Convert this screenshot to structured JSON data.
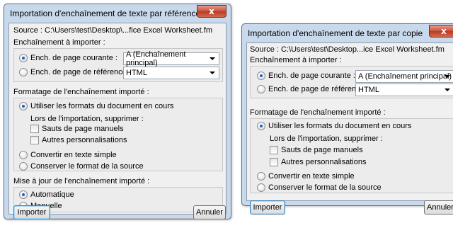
{
  "dialog_ref": {
    "title": "Importation d'enchaînement de texte par référence",
    "close_label": "x",
    "source_label": "Source : C:\\Users\\test\\Desktop\\...fice Excel Worksheet.fm",
    "group_import_title": "Enchaînement à importer :",
    "radio_current": "Ench. de page courante :",
    "radio_reference": "Ench. de page de référence :",
    "combo_current_value": "A (Enchaînement principal)",
    "combo_reference_value": "HTML",
    "group_format_title": "Formatage de l'enchaînement importé :",
    "radio_use_formats": "Utiliser les formats du document en cours",
    "remove_label": "Lors de l'importation, supprimer :",
    "check_page_breaks": "Sauts de page manuels",
    "check_other": "Autres personnalisations",
    "radio_convert": "Convertir en texte simple",
    "radio_keep": "Conserver le format de la source",
    "group_update_title": "Mise à jour de l'enchaînement importé :",
    "radio_auto": "Automatique",
    "radio_manual": "Manuelle",
    "import_button": "Importer",
    "cancel_button": "Annuler"
  },
  "dialog_copy": {
    "title": "Importation d'enchaînement de texte par copie",
    "close_label": "x",
    "source_label": "Source : C:\\Users\\test\\Desktop...ice Excel Worksheet.fm",
    "group_import_title": "Enchaînement à importer :",
    "radio_current": "Ench. de page courante :",
    "radio_reference": "Ench. de page de référence :",
    "combo_current_value": "A (Enchaînement principal)",
    "combo_reference_value": "HTML",
    "group_format_title": "Formatage de l'enchaînement importé :",
    "radio_use_formats": "Utiliser les formats du document en cours",
    "remove_label": "Lors de l'importation, supprimer :",
    "check_page_breaks": "Sauts de page manuels",
    "check_other": "Autres personnalisations",
    "radio_convert": "Convertir en texte simple",
    "radio_keep": "Conserver le format de la source",
    "import_button": "Importer",
    "cancel_button": "Annuler"
  }
}
